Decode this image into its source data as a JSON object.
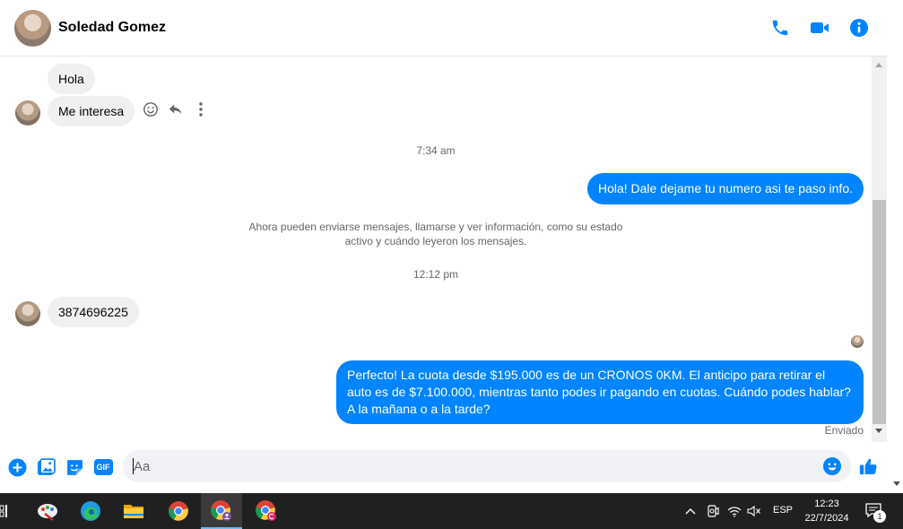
{
  "header": {
    "contact_name": "Soledad Gomez",
    "icons": [
      "phone-icon",
      "video-camera-icon",
      "info-icon"
    ],
    "accent_color": "#0084ff"
  },
  "messages": {
    "incoming_1": "Hola",
    "incoming_2": "Me interesa",
    "time_1": "7:34 am",
    "outgoing_1": "Hola! Dale dejame tu numero  asi te paso info.",
    "notice": "Ahora pueden enviarse mensajes, llamarse y ver información, como su estado activo y cuándo leyeron los mensajes.",
    "time_2": "12:12 pm",
    "incoming_3": "3874696225",
    "outgoing_2": "Perfecto! La cuota desde $195.000 es de un CRONOS 0KM. El anticipo para retirar el auto es de $7.100.000, mientras tanto podes ir pagando en cuotas. Cuándo podes hablar? A la mañana o a la tarde?",
    "status": "Enviado"
  },
  "composer": {
    "placeholder": "Aa",
    "icons": [
      "plus-icon",
      "photo-icon",
      "sticker-icon",
      "gif-icon",
      "emoji-icon",
      "like-icon"
    ],
    "gif_label": "GIF"
  },
  "taskbar": {
    "apps": [
      "paint-app",
      "edge-browser",
      "file-explorer",
      "chrome-browser",
      "chrome-profile-1",
      "chrome-profile-2"
    ],
    "language": "ESP",
    "time": "12:23",
    "date": "22/7/2024",
    "notification_count": "1"
  }
}
